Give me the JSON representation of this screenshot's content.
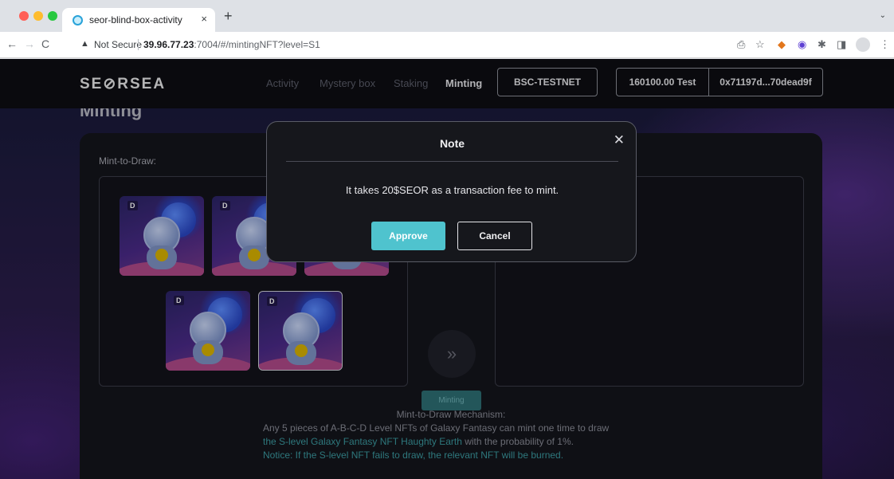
{
  "browser": {
    "tab_title": "seor-blind-box-activity",
    "tab_close": "×",
    "new_tab": "+",
    "tab_menu": "⌄",
    "not_secure": "Not Secure",
    "url_host": "39.96.77.23",
    "url_rest": ":7004/#/mintingNFT?level=S1",
    "nav_back": "←",
    "nav_forward": "→",
    "nav_reload": "C",
    "warn_icon": "▲",
    "toolbar_icons": [
      "share-icon",
      "star-icon",
      "metamask-extension-icon",
      "extension-icon",
      "puzzle-icon",
      "sidepanel-icon",
      "profile-icon",
      "menu-icon"
    ]
  },
  "header": {
    "logo": "SE⊘RSEA",
    "nav": [
      "Activity",
      "Mystery box",
      "Staking",
      "Minting"
    ],
    "active_nav": "Minting",
    "network": "BSC-TESTNET",
    "balance": "160100.00 Test",
    "address": "0x71197d...70dead9f"
  },
  "page": {
    "heading": "Minting"
  },
  "panel": {
    "mint_label": "Mint-to-Draw:",
    "cards": [
      {
        "level": "D"
      },
      {
        "level": "D"
      },
      {
        "level": "D"
      },
      {
        "level": "D"
      },
      {
        "level": "D"
      }
    ],
    "arrow": "»",
    "minting_button": "Minting",
    "mechanism": {
      "title": "Mint-to-Draw Mechanism:",
      "line1": "Any 5 pieces of A-B-C-D Level NFTs of Galaxy Fantasy can mint one time to draw",
      "line2_highlight": "the S-level Galaxy Fantasy NFT Haughty Earth",
      "line2_rest": " with the probability of 1%.",
      "line3": "Notice: If the S-level NFT fails to draw, the relevant NFT will be burned."
    }
  },
  "modal": {
    "title": "Note",
    "close": "✕",
    "message": "It takes 20$SEOR as a transaction fee to mint.",
    "approve": "Approve",
    "cancel": "Cancel"
  },
  "colors": {
    "accent": "#4fc3ce",
    "teal_text": "#3b9aa0",
    "page_bg": "#0f1018"
  }
}
